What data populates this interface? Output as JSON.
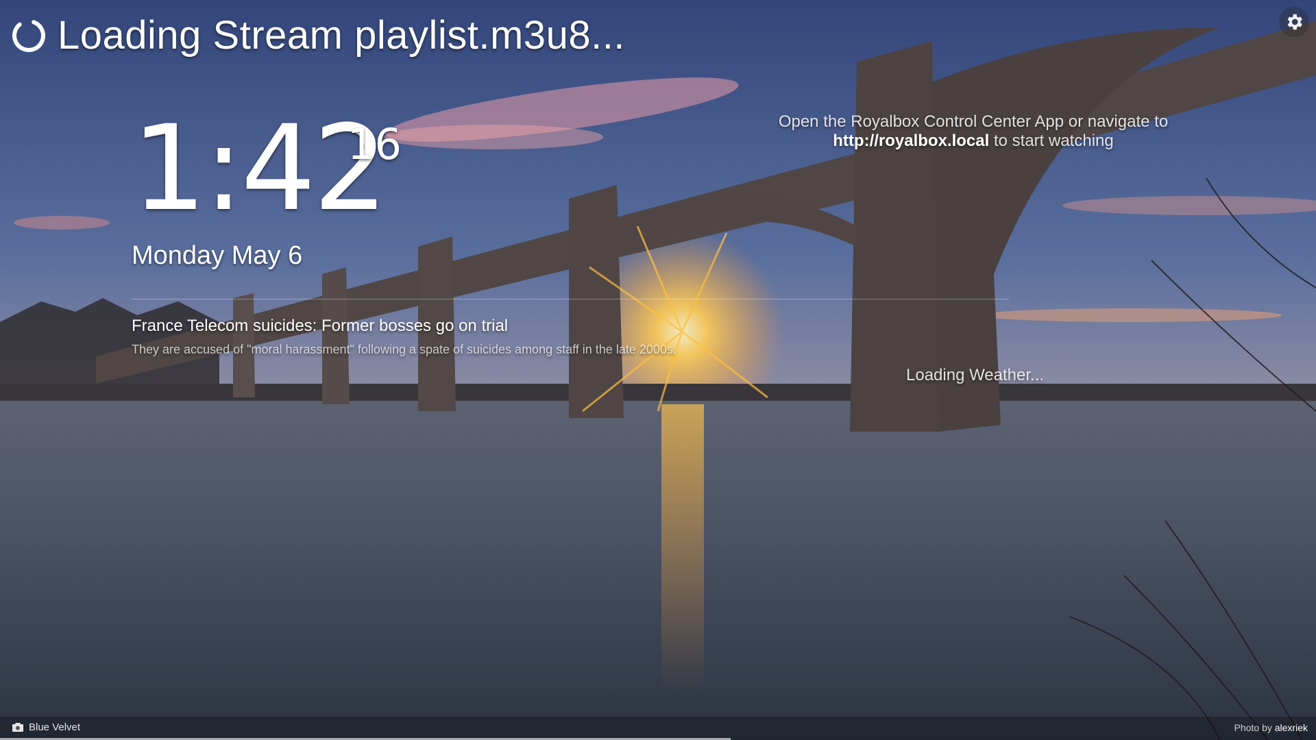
{
  "status": {
    "loading_text": "Loading Stream playlist.m3u8..."
  },
  "clock": {
    "hours_minutes": "1:42",
    "seconds": "16"
  },
  "date": "Monday May 6",
  "news": {
    "headline": "France Telecom suicides: Former bosses go on trial",
    "summary": "They are accused of \"moral harassment\" following a spate of suicides among staff in the late 2000s."
  },
  "instructions": {
    "line1": "Open the Royalbox Control Center App or navigate to",
    "link": "http://royalbox.local",
    "line2_suffix": " to start watching"
  },
  "weather": {
    "status": "Loading Weather..."
  },
  "footer": {
    "background_name": "Blue Velvet",
    "credit_prefix": "Photo by",
    "credit_author": "alexriek",
    "progress": 0.555
  },
  "icons": {
    "spinner": "spinner-icon",
    "settings": "gear-icon",
    "camera": "camera-icon"
  },
  "colors": {
    "sky_top": "#3e4f78",
    "sky_horizon": "#c9894f",
    "sun": "#ffd25a",
    "water": "#4a5566"
  }
}
